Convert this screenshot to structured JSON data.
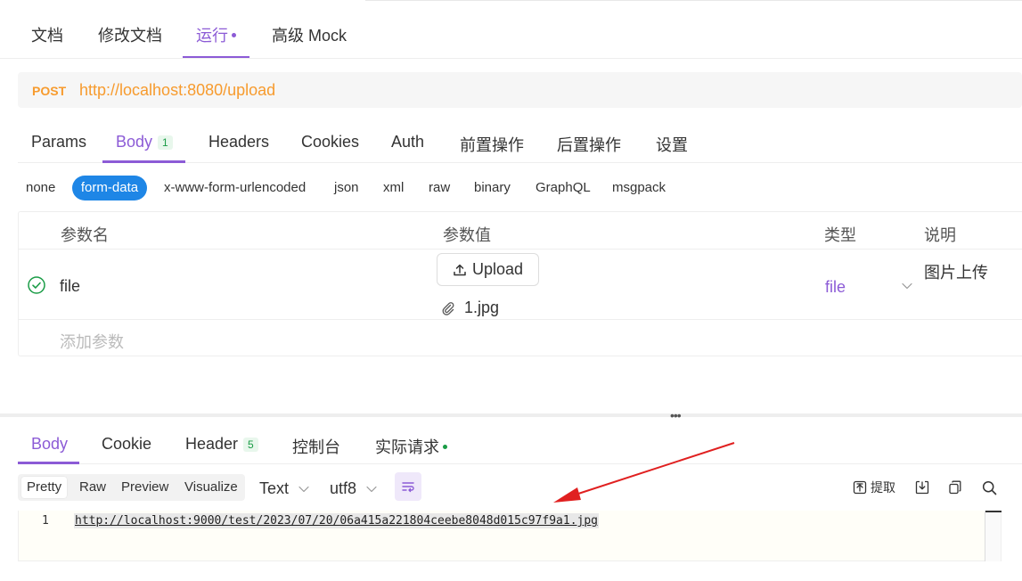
{
  "top_tabs": {
    "doc": "文档",
    "edit_doc": "修改文档",
    "run": "运行",
    "mock": "高级 Mock"
  },
  "request": {
    "method": "POST",
    "url": "http://localhost:8080/upload"
  },
  "request_tabs": {
    "params": "Params",
    "body": "Body",
    "body_count": "1",
    "headers": "Headers",
    "cookies": "Cookies",
    "auth": "Auth",
    "pre": "前置操作",
    "post": "后置操作",
    "settings": "设置"
  },
  "body_types": {
    "none": "none",
    "form_data": "form-data",
    "urlencoded": "x-www-form-urlencoded",
    "json": "json",
    "xml": "xml",
    "raw": "raw",
    "binary": "binary",
    "graphql": "GraphQL",
    "msgpack": "msgpack"
  },
  "params_table": {
    "headers": {
      "name": "参数名",
      "value": "参数值",
      "type": "类型",
      "desc": "说明"
    },
    "rows": [
      {
        "name": "file",
        "upload_label": "Upload",
        "file_name": "1.jpg",
        "type": "file",
        "desc": "图片上传"
      }
    ],
    "add_placeholder": "添加参数"
  },
  "response_tabs": {
    "body": "Body",
    "cookie": "Cookie",
    "header": "Header",
    "header_count": "5",
    "console": "控制台",
    "actual": "实际请求"
  },
  "response_toolbar": {
    "views": {
      "pretty": "Pretty",
      "raw": "Raw",
      "preview": "Preview",
      "visualize": "Visualize"
    },
    "format": "Text",
    "encoding": "utf8",
    "extract": "提取"
  },
  "response_body": {
    "line_number": "1",
    "content": "http://localhost:9000/test/2023/07/20/06a415a221804ceebe8048d015c97f9a1.jpg"
  },
  "colors": {
    "accent": "#8c5bd6",
    "method": "#f79b2e",
    "pill": "#1e86e6",
    "success": "#1a9c46",
    "annotation_arrow": "#e02020"
  }
}
